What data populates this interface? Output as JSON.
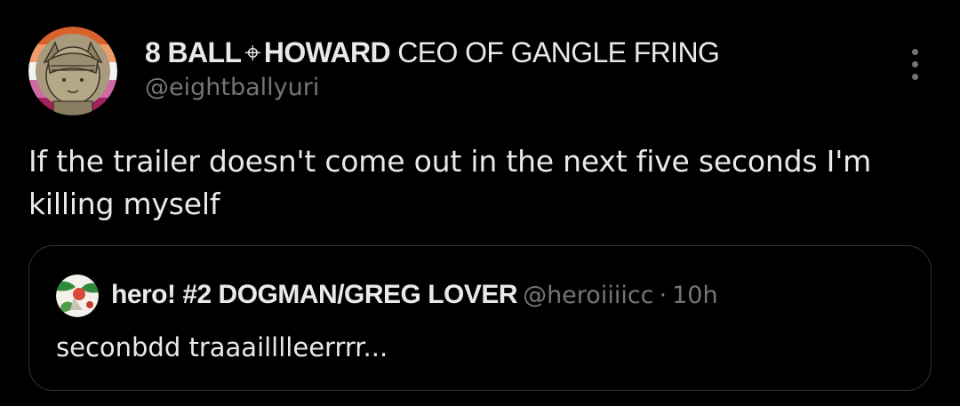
{
  "tweet": {
    "author": {
      "name_bold": "8 BALL",
      "name_symbol": "⌖",
      "name_bold_2": "HOWARD",
      "name_rest": " CEO OF GANGLE FRING",
      "handle": "@eightballyuri",
      "avatar_icon": "cartoon-character-avatar"
    },
    "text": "If the trailer doesn't come out in the next five seconds I'm killing myself",
    "more_icon": "more-options-icon",
    "quoted_tweet": {
      "author_name": "hero! #2 DOGMAN/GREG LOVER",
      "handle": "@heroiiiicc",
      "separator": "·",
      "time": "10h",
      "text": "seconbdd traaailllleerrrr...",
      "avatar_icon": "quoted-user-avatar"
    }
  }
}
